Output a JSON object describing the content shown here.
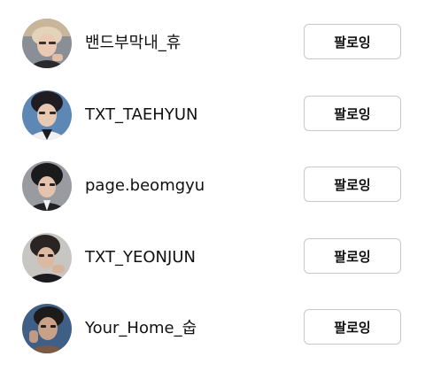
{
  "following_list": [
    {
      "username": "밴드부막내_휴",
      "button_label": "팔로잉",
      "avatar": "avatar-photo"
    },
    {
      "username": "TXT_TAEHYUN",
      "button_label": "팔로잉",
      "avatar": "avatar-photo"
    },
    {
      "username": "page.beomgyu",
      "button_label": "팔로잉",
      "avatar": "avatar-photo"
    },
    {
      "username": "TXT_YEONJUN",
      "button_label": "팔로잉",
      "avatar": "avatar-photo"
    },
    {
      "username": "Your_Home_숩",
      "button_label": "팔로잉",
      "avatar": "avatar-photo"
    }
  ],
  "colors": {
    "background": "#ffffff",
    "text": "#111111",
    "button_border": "#c8c8c8"
  }
}
